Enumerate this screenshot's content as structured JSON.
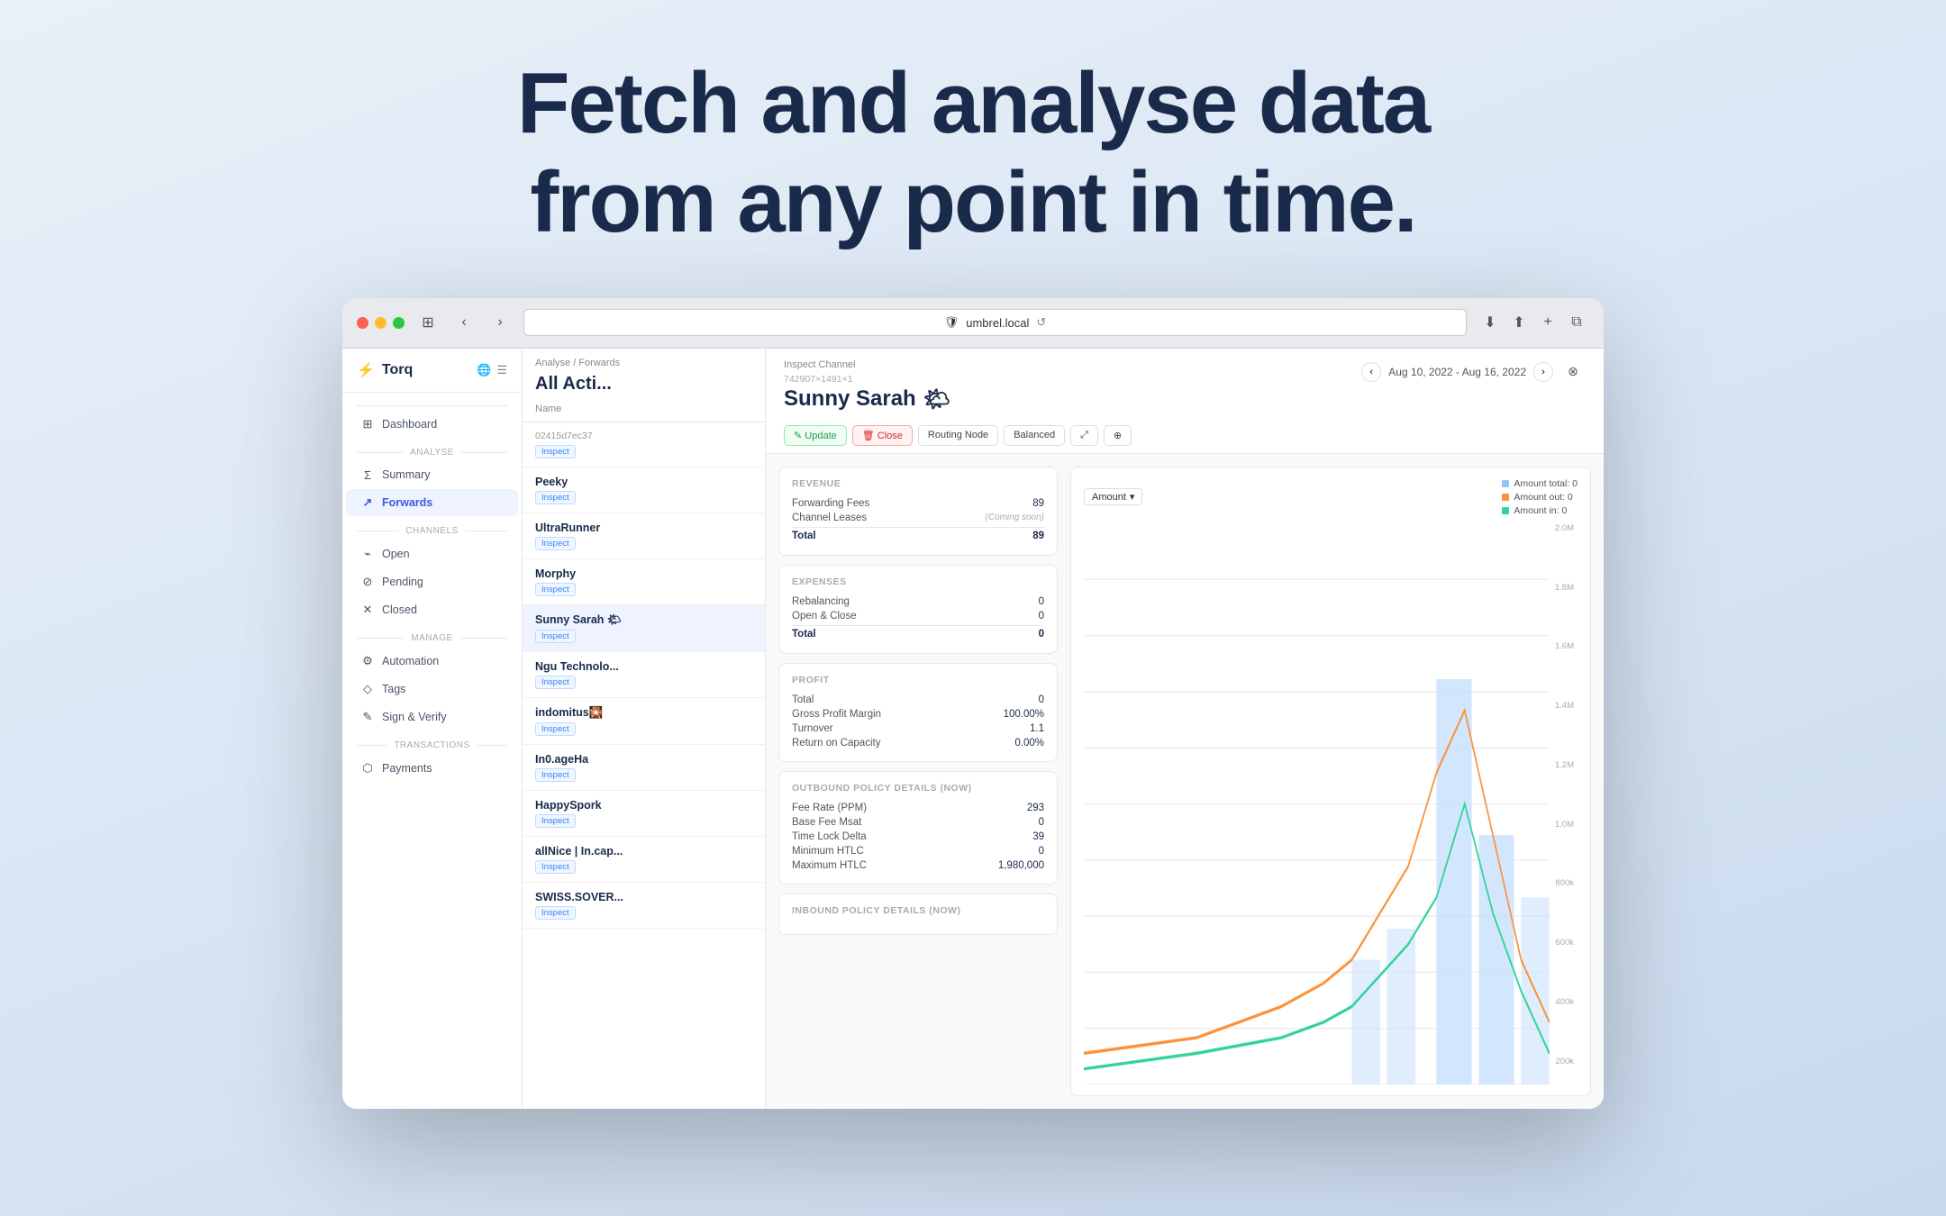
{
  "hero": {
    "line1": "Fetch and analyse data",
    "line2": "from any point in time."
  },
  "browser": {
    "url": "umbrel.local",
    "reload_icon": "↺"
  },
  "sidebar": {
    "app_name": "Torq",
    "sections": [
      {
        "label": "",
        "items": [
          {
            "id": "dashboard",
            "label": "Dashboard",
            "icon": "⊞",
            "active": false
          }
        ]
      },
      {
        "label": "Analyse",
        "items": [
          {
            "id": "summary",
            "label": "Summary",
            "icon": "Σ",
            "active": false
          },
          {
            "id": "forwards",
            "label": "Forwards",
            "icon": "↗",
            "active": true
          }
        ]
      },
      {
        "label": "Channels",
        "items": [
          {
            "id": "open",
            "label": "Open",
            "icon": "⌁",
            "active": false
          },
          {
            "id": "pending",
            "label": "Pending",
            "icon": "⌀",
            "active": false
          },
          {
            "id": "closed",
            "label": "Closed",
            "icon": "✕",
            "active": false
          }
        ]
      },
      {
        "label": "Manage",
        "items": [
          {
            "id": "automation",
            "label": "Automation",
            "icon": "⚙",
            "active": false
          },
          {
            "id": "tags",
            "label": "Tags",
            "icon": "◇",
            "active": false
          },
          {
            "id": "sign-verify",
            "label": "Sign & Verify",
            "icon": "✎",
            "active": false
          }
        ]
      },
      {
        "label": "Transactions",
        "items": [
          {
            "id": "payments",
            "label": "Payments",
            "icon": "⬡",
            "active": false
          }
        ]
      }
    ]
  },
  "activity": {
    "breadcrumb": "Analyse / Forwards",
    "title": "All Acti...",
    "column_name": "Name",
    "rows": [
      {
        "id": "02415d7ec37",
        "name": "",
        "tags": [
          "Inspect"
        ]
      },
      {
        "id": "",
        "name": "Peeky",
        "tags": [
          "Inspect"
        ]
      },
      {
        "id": "",
        "name": "UltraRunner",
        "tags": [
          "Inspect"
        ]
      },
      {
        "id": "",
        "name": "Morphy",
        "tags": [
          "Inspect"
        ]
      },
      {
        "id": "",
        "name": "Sunny Sarah 🌤",
        "tags": [
          "Inspect"
        ],
        "selected": true
      },
      {
        "id": "",
        "name": "Ngu Technolo...",
        "tags": [
          "Inspect"
        ]
      },
      {
        "id": "",
        "name": "indomitus🎇",
        "tags": [
          "Inspect"
        ]
      },
      {
        "id": "",
        "name": "In0.ageHa",
        "tags": [
          "Inspect"
        ]
      },
      {
        "id": "",
        "name": "HappySpork",
        "tags": [
          "Inspect"
        ]
      },
      {
        "id": "",
        "name": "allNice | In.cap...",
        "tags": [
          "Inspect"
        ]
      },
      {
        "id": "",
        "name": "SWISS.SOVER...",
        "tags": [
          "Inspect"
        ]
      }
    ]
  },
  "detail": {
    "inspect_label": "Inspect Channel",
    "channel_id": "742907×1491×1",
    "channel_name": "Sunny Sarah",
    "channel_emoji": "🌤",
    "date_range": "Aug 10, 2022 - Aug 16, 2022",
    "actions": [
      {
        "id": "update",
        "label": "Update",
        "icon": "✎",
        "style": "green"
      },
      {
        "id": "close",
        "label": "Close",
        "icon": "🗑",
        "style": "red"
      },
      {
        "id": "routing-node",
        "label": "Routing Node",
        "style": "default"
      },
      {
        "id": "balanced",
        "label": "Balanced",
        "style": "default"
      },
      {
        "id": "icon1",
        "label": "⤢",
        "style": "default"
      },
      {
        "id": "icon2",
        "label": "⊕",
        "style": "default"
      }
    ],
    "revenue_card": {
      "title": "Revenue",
      "rows": [
        {
          "label": "Forwarding Fees",
          "value": "89"
        },
        {
          "label": "Channel Leases",
          "value": "(Coming soon)"
        },
        {
          "label": "Total",
          "value": "89",
          "total": true
        }
      ]
    },
    "expenses_card": {
      "title": "Expenses",
      "rows": [
        {
          "label": "Rebalancing",
          "value": "0"
        },
        {
          "label": "Open & Close",
          "value": "0"
        },
        {
          "label": "Total",
          "value": "0",
          "total": true
        }
      ]
    },
    "profit_card": {
      "title": "Profit",
      "rows": [
        {
          "label": "Total",
          "value": "0"
        },
        {
          "label": "Gross Profit Margin",
          "value": "100.00%"
        },
        {
          "label": "Turnover",
          "value": "1.1"
        },
        {
          "label": "Return on Capacity",
          "value": "0.00%"
        }
      ]
    },
    "outbound_policy_card": {
      "title": "Outbound Policy Details (now)",
      "rows": [
        {
          "label": "Fee Rate (PPM)",
          "value": "293"
        },
        {
          "label": "Base Fee Msat",
          "value": "0"
        },
        {
          "label": "Time Lock Delta",
          "value": "39"
        },
        {
          "label": "Minimum HTLC",
          "value": "0"
        },
        {
          "label": "Maximum HTLC",
          "value": "1,980,000"
        }
      ]
    },
    "inbound_policy_label": "Inbound Policy Details (now)",
    "chart": {
      "selector_label": "Amount",
      "legend": [
        {
          "label": "Amount total: 0",
          "color": "#93c5fd"
        },
        {
          "label": "Amount out: 0",
          "color": "#fb923c"
        },
        {
          "label": "Amount in: 0",
          "color": "#34d399"
        }
      ],
      "y_labels": [
        "2.0M",
        "1.8M",
        "1.6M",
        "1.4M",
        "1.2M",
        "1.0M",
        "800k",
        "600k",
        "400k",
        "200k"
      ]
    }
  }
}
